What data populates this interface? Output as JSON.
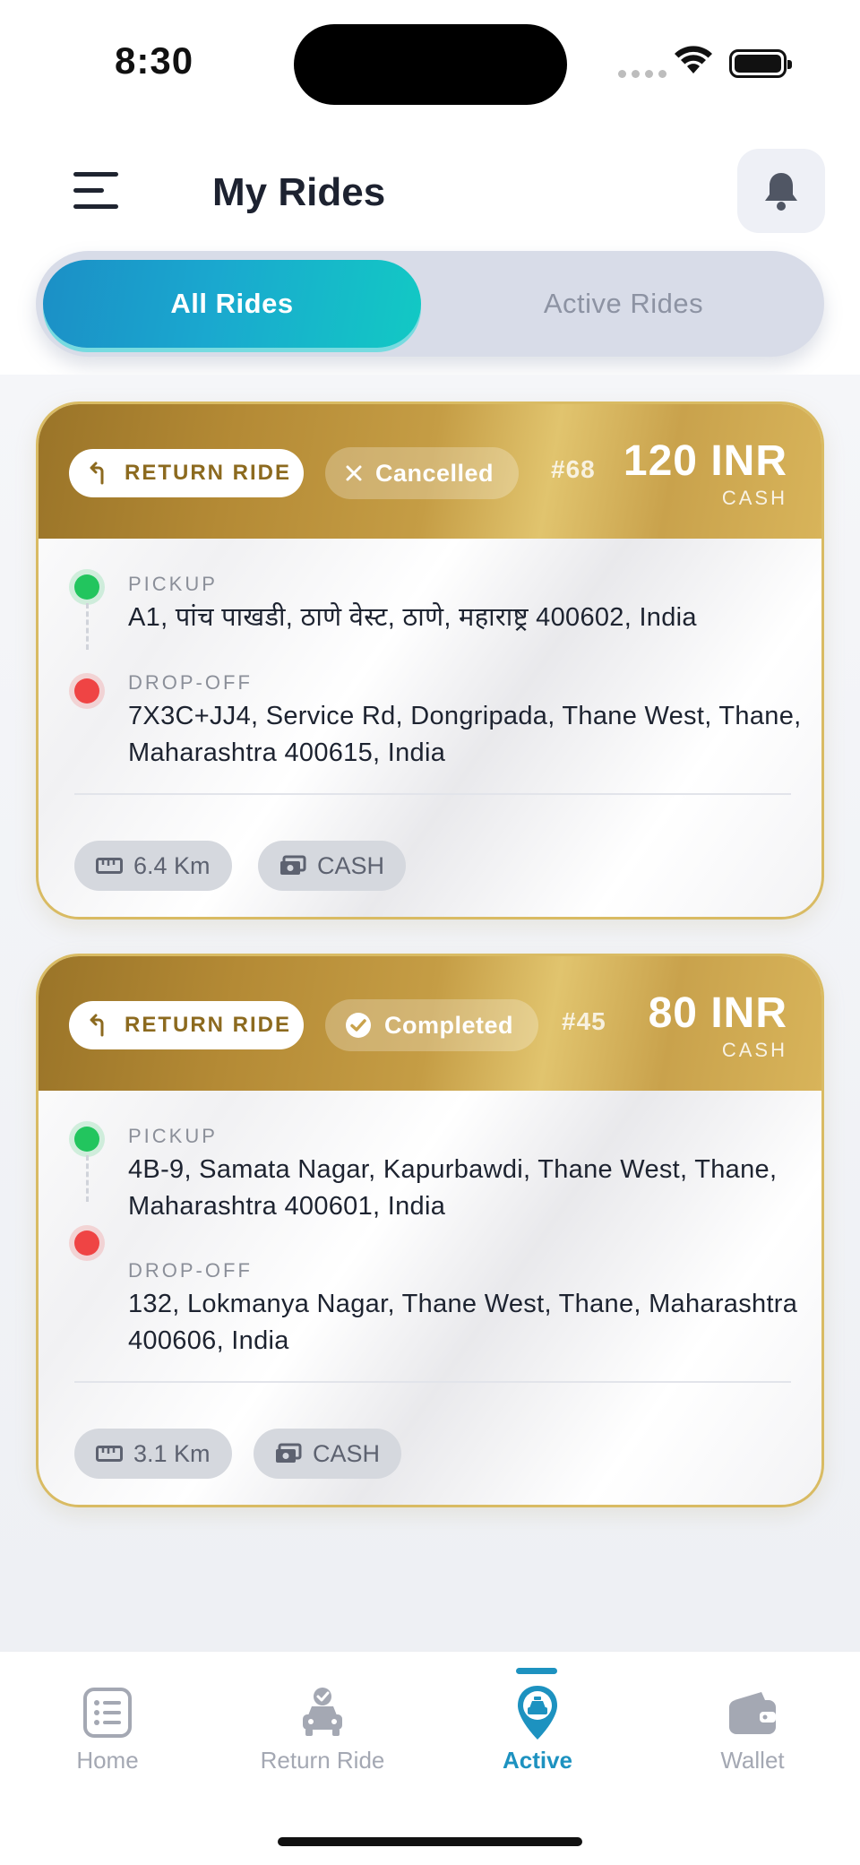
{
  "status_bar": {
    "time": "8:30"
  },
  "header": {
    "title": "My Rides"
  },
  "tabs": [
    {
      "label": "All Rides",
      "selected": true
    },
    {
      "label": "Active Rides",
      "selected": false
    }
  ],
  "rides": [
    {
      "type_label": "RETURN RIDE",
      "status": "Cancelled",
      "number": "#68",
      "fare": "120 INR",
      "fare_mode": "CASH",
      "pickup_label": "PICKUP",
      "pickup": "A1, पांच पाखडी, ठाणे वेस्ट, ठाणे, महाराष्ट्र 400602, India",
      "dropoff_label": "DROP-OFF",
      "dropoff": "7X3C+JJ4, Service Rd, Dongripada, Thane West, Thane, Maharashtra 400615, India",
      "distance": "6.4 Km",
      "payment": "CASH"
    },
    {
      "type_label": "RETURN RIDE",
      "status": "Completed",
      "number": "#45",
      "fare": "80 INR",
      "fare_mode": "CASH",
      "pickup_label": "PICKUP",
      "pickup": "4B-9, Samata Nagar, Kapurbawdi, Thane West, Thane, Maharashtra 400601, India",
      "dropoff_label": "DROP-OFF",
      "dropoff": "132, Lokmanya Nagar, Thane West, Thane, Maharashtra 400606, India",
      "distance": "3.1 Km",
      "payment": "CASH"
    }
  ],
  "bottom_nav": [
    {
      "label": "Home",
      "icon": "list-icon",
      "active": false
    },
    {
      "label": "Return Ride",
      "icon": "car-check-icon",
      "active": false
    },
    {
      "label": "Active",
      "icon": "taxi-pin-icon",
      "active": true
    },
    {
      "label": "Wallet",
      "icon": "wallet-icon",
      "active": false
    }
  ],
  "colors": {
    "accent": "#1d92c0",
    "gold": "#c59d45",
    "pickup": "#22c55e",
    "dropoff": "#ef4444"
  }
}
